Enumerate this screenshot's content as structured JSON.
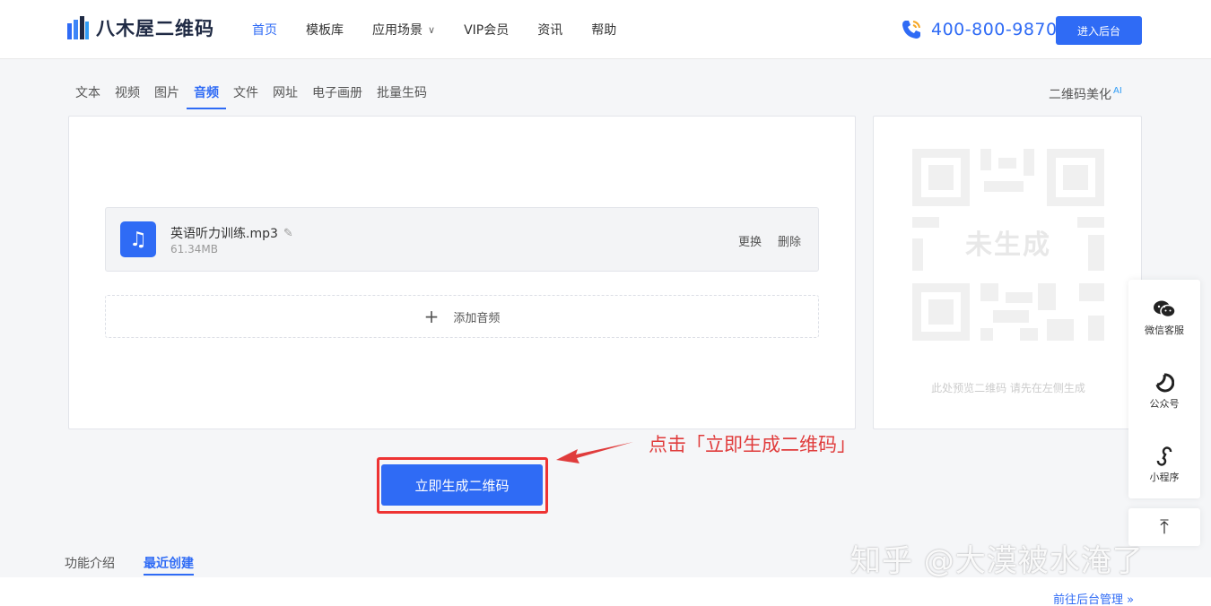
{
  "header": {
    "logo_text": "八木屋二维码",
    "nav": [
      {
        "label": "首页",
        "active": true
      },
      {
        "label": "模板库"
      },
      {
        "label": "应用场景",
        "dropdown": true
      },
      {
        "label": "VIP会员"
      },
      {
        "label": "资讯"
      },
      {
        "label": "帮助"
      }
    ],
    "phone": "400-800-9870",
    "admin_button": "进入后台"
  },
  "tabs": [
    {
      "label": "文本"
    },
    {
      "label": "视频"
    },
    {
      "label": "图片"
    },
    {
      "label": "音频",
      "active": true
    },
    {
      "label": "文件"
    },
    {
      "label": "网址"
    },
    {
      "label": "电子画册"
    },
    {
      "label": "批量生码"
    }
  ],
  "beautify": {
    "label": "二维码美化",
    "badge": "AI"
  },
  "file": {
    "name": "英语听力训练.mp3",
    "size": "61.34MB",
    "replace": "更换",
    "delete": "删除"
  },
  "add_audio": "添加音频",
  "qr_preview": {
    "status": "未生成",
    "hint": "此处预览二维码 请先在左侧生成"
  },
  "generate_button": "立即生成二维码",
  "annotation": "点击「立即生成二维码」",
  "floatbar": [
    {
      "label": "微信客服",
      "icon": "wechat-icon"
    },
    {
      "label": "公众号",
      "icon": "official-account-icon"
    },
    {
      "label": "小程序",
      "icon": "mini-program-icon"
    }
  ],
  "bottom_tabs": [
    {
      "label": "功能介绍"
    },
    {
      "label": "最近创建",
      "active": true
    }
  ],
  "goto_admin": "前往后台管理 »",
  "watermark": "知乎 @大漠被水淹了",
  "colors": {
    "primary": "#2f6bf5",
    "annotation": "#e03c3c"
  }
}
